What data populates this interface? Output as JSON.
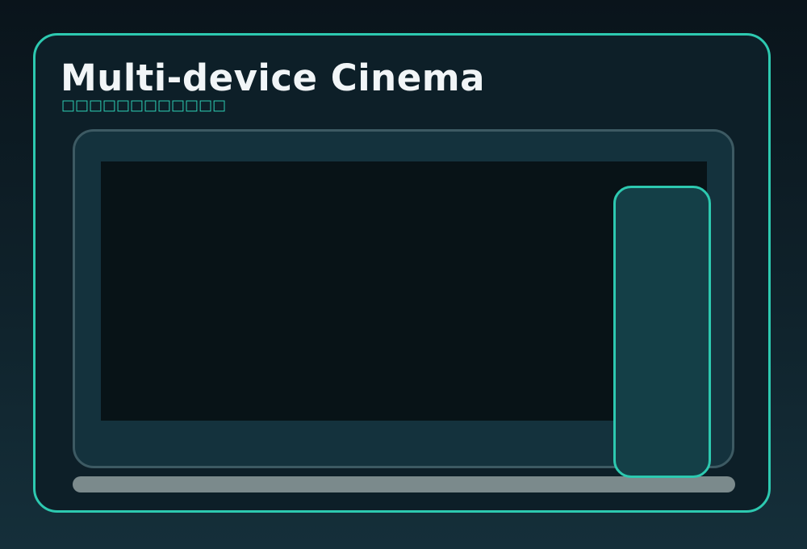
{
  "header": {
    "title": "Multi-device Cinema",
    "subtitle": "□□□□□□□□□□□□"
  },
  "colors": {
    "accent": "#2dc9b0",
    "background_top": "#0a141b",
    "background_bottom": "#152f3a",
    "card": "#0d1f28",
    "monitor_frame": "#14323d",
    "monitor_border": "#3d5a63",
    "screen": "#081317",
    "phone": "#143f47",
    "stand": "#7b8a8c",
    "title_text": "#f1f5f7"
  },
  "devices": {
    "monitor": "desktop-monitor",
    "phone": "smartphone"
  }
}
